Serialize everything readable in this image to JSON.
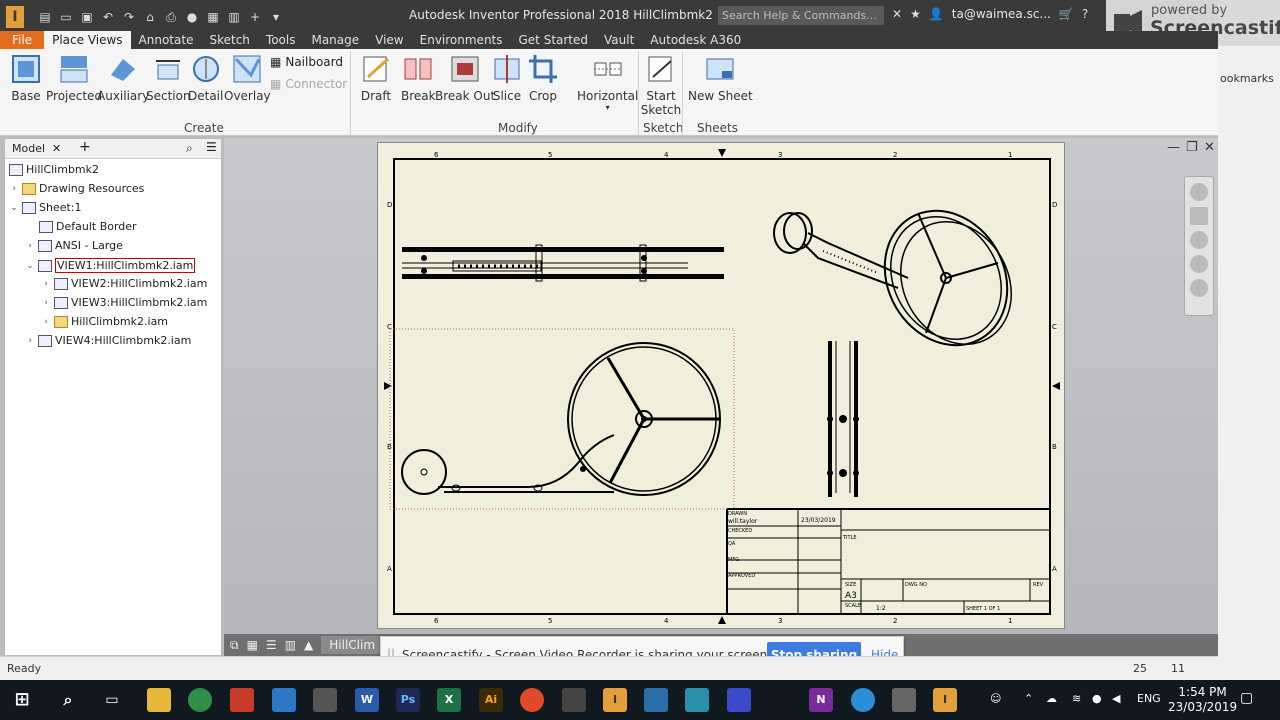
{
  "titlebar": {
    "title": "Autodesk Inventor Professional 2018    HillClimbmk2",
    "search_placeholder": "Search Help & Commands...",
    "user": "ta@waimea.sc..."
  },
  "tabs": [
    "File",
    "Place Views",
    "Annotate",
    "Sketch",
    "Tools",
    "Manage",
    "View",
    "Environments",
    "Get Started",
    "Vault",
    "Autodesk A360"
  ],
  "ribbon": {
    "create": [
      "Base",
      "Projected",
      "Auxiliary",
      "Section",
      "Detail",
      "Overlay"
    ],
    "create_small": [
      "Nailboard",
      "Connector"
    ],
    "create_label": "Create",
    "modify": [
      "Draft",
      "Break",
      "Break Out",
      "Slice",
      "Crop"
    ],
    "horizontal": "Horizontal",
    "modify_label": "Modify",
    "start_sketch": "Start Sketch",
    "sketch_label": "Sketch",
    "new_sheet": "New Sheet",
    "sheets_label": "Sheets"
  },
  "screencastify": {
    "powered_by": "powered by",
    "name": "Screencastify",
    "bookmarks": "ookmarks"
  },
  "browser": {
    "title": "Model",
    "nodes": [
      "HillClimbmk2",
      "Drawing Resources",
      "Sheet:1",
      "Default Border",
      "ANSI - Large",
      "VIEW1:HillClimbmk2.iam",
      "VIEW2:HillClimbmk2.iam",
      "VIEW3:HillClimbmk2.iam",
      "HillClimbmk2.iam",
      "VIEW4:HillClimbmk2.iam"
    ]
  },
  "titleblock": {
    "drawn": "DRAWN",
    "author": "will.taylor",
    "date": "23/03/2019",
    "checked": "CHECKED",
    "qa": "QA",
    "mfg": "MFG",
    "approved": "APPROVED",
    "title": "TITLE",
    "size": "SIZE",
    "size_val": "A3",
    "dwg_no": "DWG NO",
    "rev": "REV",
    "scale": "SCALE",
    "scale_val": "1:2",
    "sheet": "SHEET 1  OF 1"
  },
  "border": {
    "top_nums": [
      "6",
      "5",
      "4",
      "3",
      "2",
      "1"
    ],
    "side_letters": [
      "D",
      "C",
      "B",
      "A"
    ]
  },
  "viewtabs": {
    "doc": "HillClim"
  },
  "sharebar": {
    "message": "Screencastify - Screen Video Recorder is sharing your screen and audio.",
    "stop": "Stop sharing",
    "hide": "Hide"
  },
  "status": {
    "ready": "Ready",
    "n1": "25",
    "n2": "11"
  },
  "taskbar": {
    "lang": "ENG",
    "time": "1:54 PM",
    "date": "23/03/2019"
  }
}
